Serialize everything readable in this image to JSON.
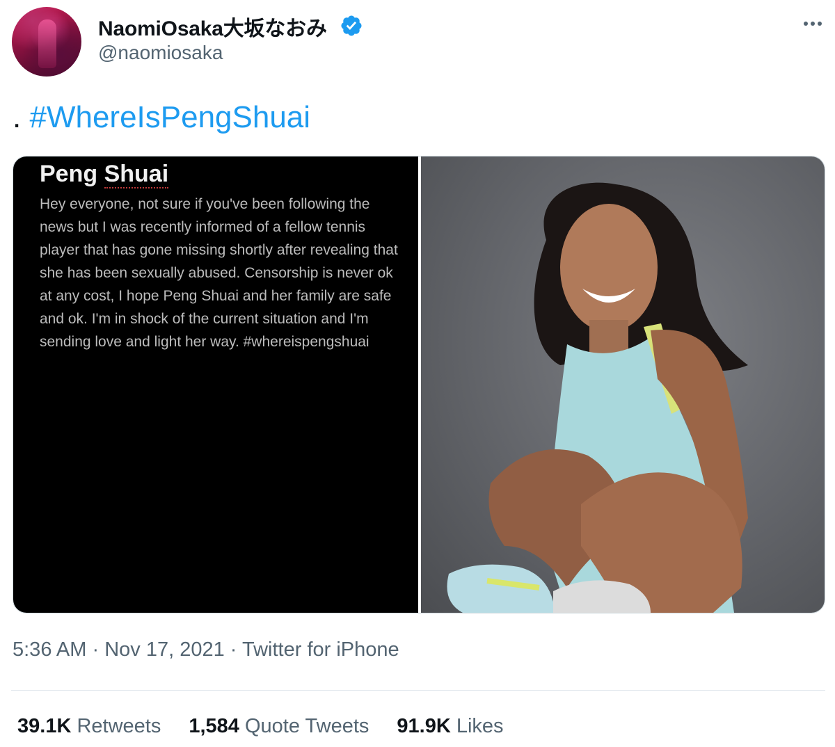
{
  "tweet": {
    "author": {
      "display_name": "NaomiOsaka大坂なおみ",
      "handle": "@naomiosaka",
      "verified": true,
      "verified_color": "#1d9bf0"
    },
    "text_prefix": ".",
    "hashtag": "#WhereIsPengShuai",
    "hashtag_color": "#1d9bf0",
    "media": {
      "left_image": {
        "title_first": "Peng",
        "title_second": "Shuai",
        "body": "Hey everyone, not sure if you've been following the news but I was recently informed of a fellow tennis player that has gone missing shortly after revealing that she has been sexually abused. Censorship is never ok at any cost, I hope Peng Shuai and her family are safe and ok. I'm in shock of the current situation and I'm sending love and light her way. #whereispengshuai"
      },
      "right_image": {
        "kind": "photo"
      }
    },
    "meta": {
      "time": "5:36 AM",
      "date": "Nov 17, 2021",
      "source": "Twitter for iPhone",
      "separator": "·"
    },
    "stats": {
      "retweets_count": "39.1K",
      "retweets_label": "Retweets",
      "quotes_count": "1,584",
      "quotes_label": "Quote Tweets",
      "likes_count": "91.9K",
      "likes_label": "Likes"
    }
  },
  "icons": {
    "verified": "verified-badge-icon",
    "more": "more-options-icon"
  }
}
